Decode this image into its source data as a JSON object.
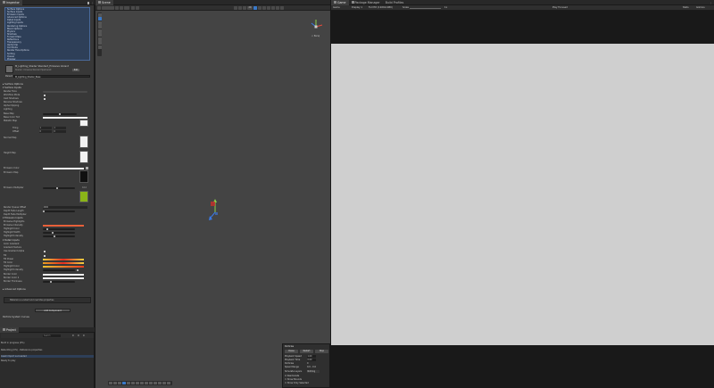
{
  "inspector": {
    "tab_label": "Inspector",
    "list_items": [
      "Surface Options",
      "Surface Inputs",
      "Emission Inputs",
      "Advanced Options",
      "Detail Inputs",
      "Lighting Inputs",
      "Rendering Options",
      "Blend Options",
      "Physics",
      "Shadows",
      "Forward Pass",
      "Reflections",
      "Transparency",
      "Alpha Clip",
      "Cull Mode",
      "Render Face Options",
      "Sorting",
      "Queue",
      "Preview"
    ],
    "material_name": "M_Lighting_Shader Standard_Emissive Variant",
    "material_subtitle": "Shader: Universal Render Pipeline/Lit",
    "edit_label": "Edit",
    "parent_label": "Parent",
    "parent_value": "M_Lighting_Shader_Base",
    "folds": [
      "Surface Options",
      "Surface Inputs",
      "Emission Inputs",
      "Detail Inputs",
      "Advanced Options"
    ],
    "props_top": [
      "Render Face",
      "Workflow Mode",
      "Cast Shadows",
      "Receive Shadows",
      "Alpha Clipping",
      "Lighting",
      "Base Map",
      "Base Color Tint",
      "Metallic Map",
      "Smoothness"
    ],
    "tiling_label": "Tiling",
    "offset_label": "Offset",
    "tiling": [
      "1",
      "1"
    ],
    "offset": [
      "0",
      "0"
    ],
    "normal_label": "Normal Map",
    "height_label": "Height Map",
    "emission_color_label": "Emission Color",
    "emission_map_label": "Emission Map",
    "emission_multiplier_label": "Emission Multiplier",
    "emission_value": "16.0",
    "props_mid": [
      "Render Queue Offset",
      "Depth Fade Length",
      "Depth Fade Multiplier",
      "Emissive Highlights",
      "Emissive Intensity",
      "Highlight Color",
      "Highlight Width",
      "Highlight Intensity"
    ],
    "queue_value": "2000",
    "props_low": [
      "Color Gradient",
      "Gradient Texture",
      "Use Gradient Alpha",
      "Fill",
      "Fill Power",
      "Fill Color",
      "Highlight Color",
      "Highlight Intensity",
      "Border Color",
      "Border Color 2",
      "Border Thickness"
    ],
    "section_footer": "Advanced Options",
    "info_text": "Material is a variant and overrides properties",
    "add_component": "Add Component"
  },
  "console": {
    "hierarchy_label": "Particle System Curves",
    "tab_label": "Project",
    "search_placeholder": "Search",
    "counts": [
      "0",
      "0",
      "0"
    ],
    "messages": [
      "Build in progress (0%)",
      "Rebuilding (0%) - Reference properties",
      "Asset import succeeded",
      "Ready to play"
    ]
  },
  "scene": {
    "tab_label": "Scene",
    "mode_2d": "2D",
    "persp_label": "< Persp",
    "gizmo_label": "Gizmos",
    "shading": "Shaded"
  },
  "particle_panel": {
    "title": "Particles",
    "buttons": [
      "Pause",
      "Restart",
      "Stop"
    ],
    "rows": [
      "Playback Speed",
      "Playback Time",
      "Particles",
      "Speed Range",
      "Simulate Layers",
      "Resimulate",
      "Show Bounds",
      "Show Only Selected"
    ],
    "values": [
      "1.00",
      "0.00",
      "0",
      "0.0 - 0.0",
      "Nothing"
    ]
  },
  "game": {
    "tabs": [
      "Game",
      "Package Manager",
      "Build Profiles"
    ],
    "display": "Display 1",
    "resolution": "Full HD (1920x1080)",
    "scale_label": "Scale",
    "scale_value": "1x",
    "play_focused": "Play Focused",
    "stats": "Stats",
    "gizmos": "Gizmos"
  },
  "colors": {
    "accent": "#3a79c8",
    "emission_swatch": "#8ab418",
    "highlight_orange": "#e8603a",
    "gradient_start": "#e83020",
    "gradient_end": "#f4d040",
    "game_bg": "#cfcfcf",
    "scene_bg": "#444444"
  },
  "icons": [
    "lock-icon",
    "menu-icon",
    "axis-gizmo",
    "move-tool-icon",
    "rotate-tool-icon",
    "scale-tool-icon",
    "hand-tool-icon"
  ]
}
